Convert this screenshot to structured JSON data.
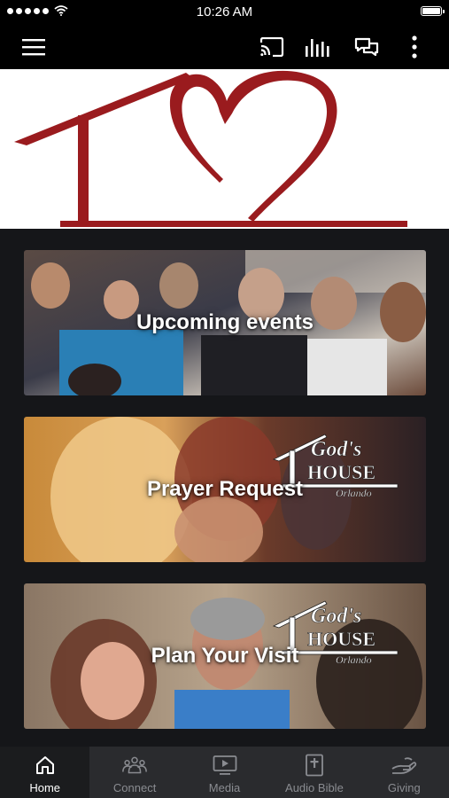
{
  "status_bar": {
    "time": "10:26 AM",
    "signal_icon": "signal-dots-icon",
    "wifi_icon": "wifi-icon",
    "battery_icon": "battery-icon"
  },
  "app_bar": {
    "icons": [
      "menu-icon",
      "cast-icon",
      "audio-bars-icon",
      "chat-icon",
      "more-vert-icon"
    ]
  },
  "banner": {
    "logo_color": "#9a1b1e"
  },
  "cards": [
    {
      "label": "Upcoming events"
    },
    {
      "label": "Prayer Request",
      "brand_line1": "God's",
      "brand_line2": "HOUSE",
      "brand_line3": "Orlando"
    },
    {
      "label": "Plan Your Visit",
      "brand_line1": "God's",
      "brand_line2": "HOUSE",
      "brand_line3": "Orlando"
    }
  ],
  "tabs": [
    {
      "label": "Home",
      "icon": "home-icon",
      "active": true
    },
    {
      "label": "Connect",
      "icon": "connect-icon",
      "active": false
    },
    {
      "label": "Media",
      "icon": "media-icon",
      "active": false
    },
    {
      "label": "Audio Bible",
      "icon": "bible-icon",
      "active": false
    },
    {
      "label": "Giving",
      "icon": "giving-icon",
      "active": false
    }
  ]
}
